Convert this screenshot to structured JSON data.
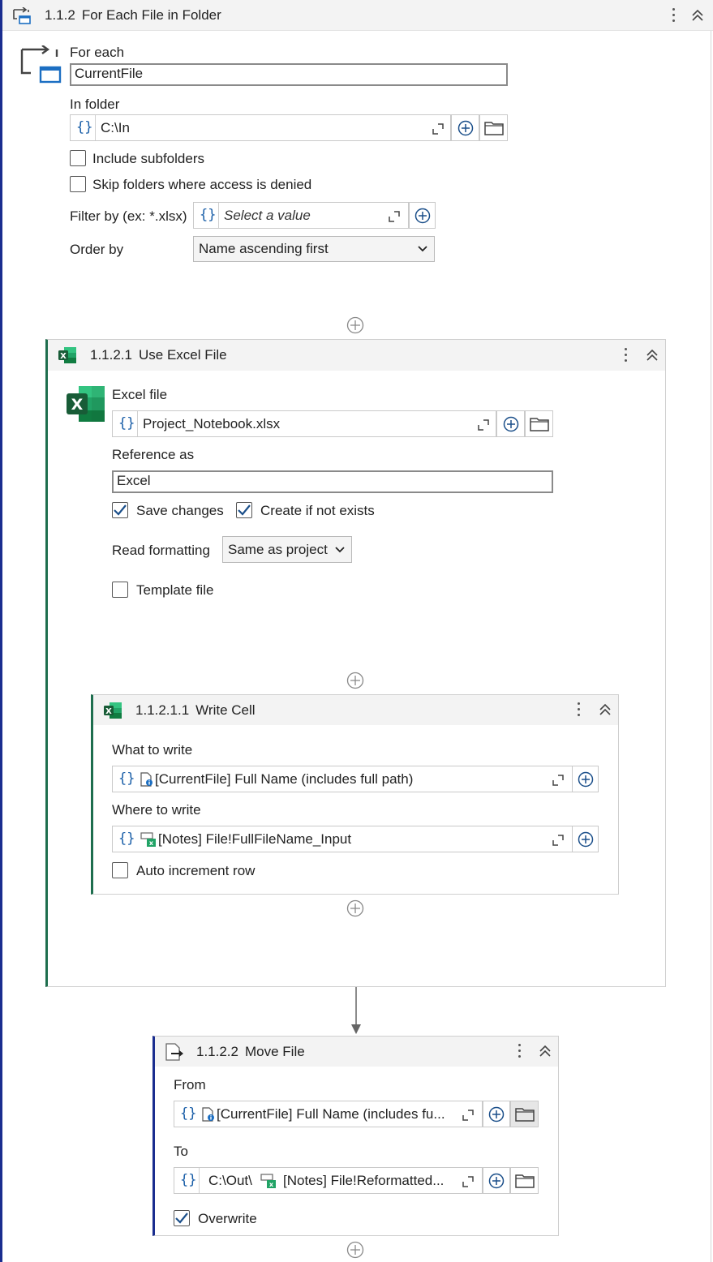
{
  "for_each_block": {
    "number": "1.1.2",
    "title": "For Each File in Folder",
    "for_each_label": "For each",
    "for_each_value": "CurrentFile",
    "in_folder_label": "In folder",
    "in_folder_value": "C:\\In",
    "include_subfolders_label": "Include subfolders",
    "include_subfolders_checked": false,
    "skip_folders_label": "Skip folders where access is denied",
    "skip_folders_checked": false,
    "filter_label": "Filter by (ex: *.xlsx)",
    "filter_placeholder": "Select a value",
    "order_by_label": "Order by",
    "order_by_value": "Name ascending first"
  },
  "use_excel_block": {
    "number": "1.1.2.1",
    "title": "Use Excel File",
    "excel_file_label": "Excel file",
    "excel_file_value": "Project_Notebook.xlsx",
    "reference_as_label": "Reference as",
    "reference_as_value": "Excel",
    "save_changes_label": "Save changes",
    "save_changes_checked": true,
    "create_if_not_exists_label": "Create if not exists",
    "create_if_not_exists_checked": true,
    "read_formatting_label": "Read formatting",
    "read_formatting_value": "Same as project",
    "template_file_label": "Template file",
    "template_file_checked": false
  },
  "write_cell_block": {
    "number": "1.1.2.1.1",
    "title": "Write Cell",
    "what_to_write_label": "What to write",
    "what_to_write_value": "[CurrentFile] Full Name (includes full path)",
    "where_to_write_label": "Where to write",
    "where_to_write_value": "[Notes] File!FullFileName_Input",
    "auto_increment_label": "Auto increment row",
    "auto_increment_checked": false
  },
  "move_file_block": {
    "number": "1.1.2.2",
    "title": "Move File",
    "from_label": "From",
    "from_value": "[CurrentFile] Full Name (includes fu...",
    "to_label": "To",
    "to_prefix": "C:\\Out\\",
    "to_value": "[Notes] File!Reformatted...",
    "overwrite_label": "Overwrite",
    "overwrite_checked": true
  },
  "colors": {
    "left_accent": "#1a2d8f",
    "excel_accent": "#1e6e4e",
    "braces_blue": "#1b5fa8",
    "header_bg": "#f3f3f3"
  },
  "icons": [
    "for-each-folder-icon",
    "excel-icon",
    "move-file-icon",
    "kebab-menu-icon",
    "collapse-icon",
    "expand-icon",
    "add-icon",
    "folder-icon",
    "variable-braces-icon",
    "file-info-icon",
    "excel-cell-icon"
  ]
}
